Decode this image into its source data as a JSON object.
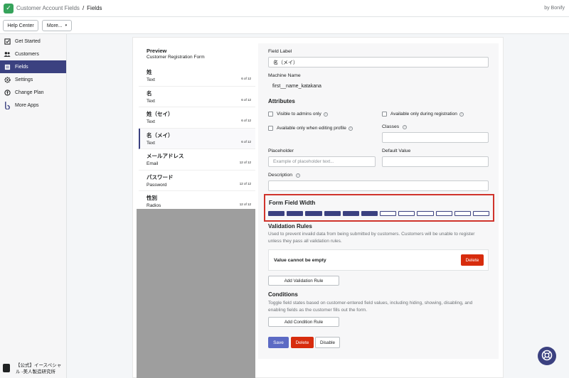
{
  "topbar": {
    "app_name": "Customer Account Fields",
    "separator": "/",
    "current": "Fields",
    "byline": "by Bonify"
  },
  "header": {
    "help_center": "Help Center",
    "more": "More...",
    "more_caret": "▾"
  },
  "sidebar": {
    "items": [
      {
        "label": "Get Started",
        "icon": "checkbox-icon"
      },
      {
        "label": "Customers",
        "icon": "people-icon"
      },
      {
        "label": "Fields",
        "icon": "list-icon"
      },
      {
        "label": "Settings",
        "icon": "gear-icon"
      },
      {
        "label": "Change Plan",
        "icon": "plan-icon"
      },
      {
        "label": "More Apps",
        "icon": "bonify-icon"
      }
    ],
    "active_index": 2,
    "store_name_line1": "【公式】イースペシャ",
    "store_name_line2": "ル -美人製造研究所"
  },
  "preview": {
    "title": "Preview",
    "subtitle": "Customer Registration Form",
    "fields": [
      {
        "name": "姓",
        "type": "Text",
        "badge": "6 of 12"
      },
      {
        "name": "名",
        "type": "Text",
        "badge": "6 of 12"
      },
      {
        "name": "姓（セイ）",
        "type": "Text",
        "badge": "6 of 12"
      },
      {
        "name": "名（メイ）",
        "type": "Text",
        "badge": "6 of 12"
      },
      {
        "name": "メールアドレス",
        "type": "Email",
        "badge": "12 of 12"
      },
      {
        "name": "パスワード",
        "type": "Password",
        "badge": "12 of 12"
      },
      {
        "name": "性別",
        "type": "Radios",
        "badge": "12 of 12"
      }
    ],
    "selected_index": 3
  },
  "form": {
    "field_label_label": "Field Label",
    "field_label_value": "名（メイ）",
    "machine_name_label": "Machine Name",
    "machine_name_value": "first__name_katakana",
    "attributes_title": "Attributes",
    "visible_admins": "Visible to admins only",
    "available_registration": "Available only during registration",
    "available_editing": "Available only when editing profile",
    "classes_label": "Classes",
    "help_glyph": "?",
    "placeholder_label": "Placeholder",
    "placeholder_placeholder": "Example of placeholder text...",
    "default_value_label": "Default Value",
    "description_label": "Description",
    "form_field_width_title": "Form Field Width",
    "width_filled": 6,
    "width_total": 12,
    "validation_title": "Validation Rules",
    "validation_desc_line1": "Used to prevent invalid data from being submitted by customers. Customers will be unable to register",
    "validation_desc_line2": "unless they pass all validation rules.",
    "rule_text": "Value cannot be empty",
    "rule_delete": "Delete",
    "add_validation": "Add Validation Rule",
    "conditions_title": "Conditions",
    "conditions_desc_line1": "Toggle field states based on customer-entered field values, including hiding, showing, disabling, and",
    "conditions_desc_line2": "enabling fields as the customer fills out the form.",
    "add_condition": "Add Condition Rule",
    "save": "Save",
    "delete": "Delete",
    "disable": "Disable"
  },
  "colors": {
    "accent": "#3b4180",
    "danger": "#d72c0d",
    "primary_button": "#5c6ac4",
    "app_logo": "#36a35b"
  }
}
